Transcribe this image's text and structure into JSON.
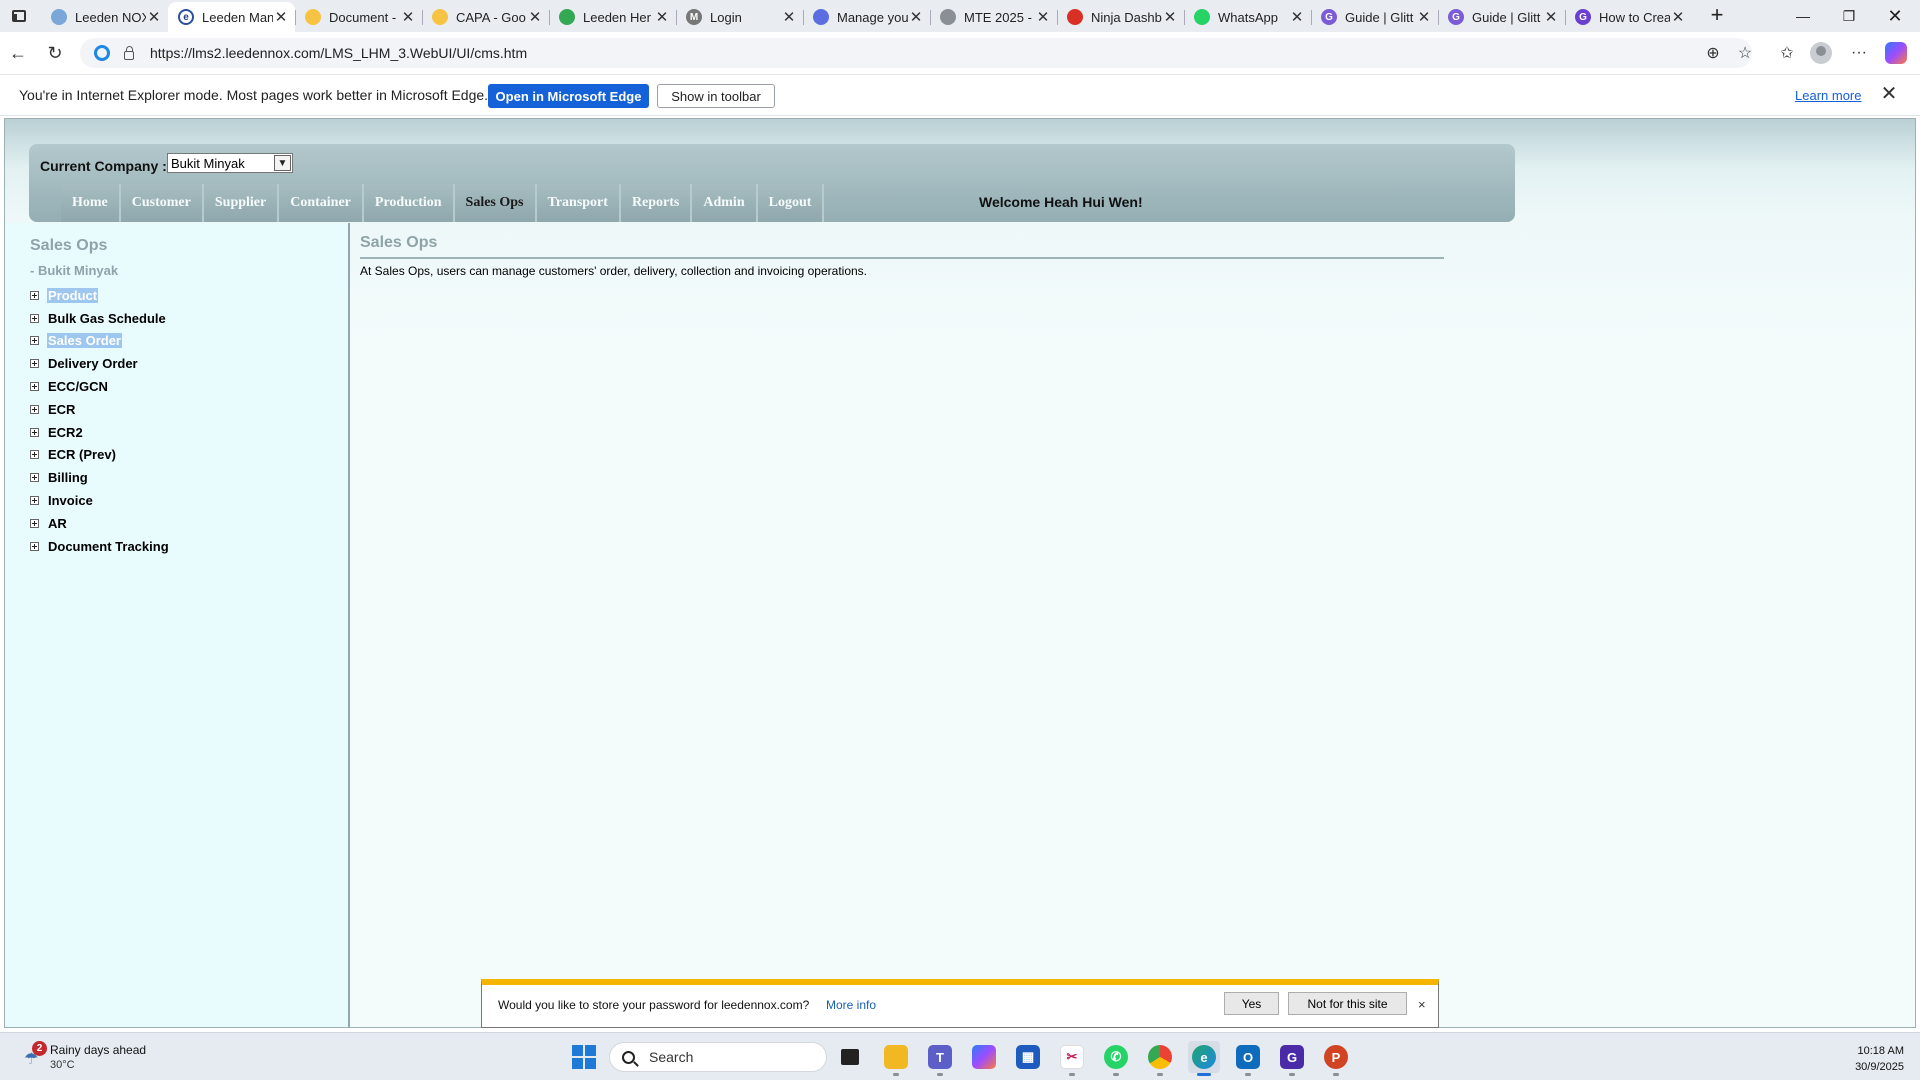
{
  "browser": {
    "tabs": [
      {
        "title": "Leeden NOX",
        "fav_color": "#7aa6d8",
        "fav_glyph": ""
      },
      {
        "title": "Leeden Man",
        "fav_color": "#ffffff",
        "fav_glyph": "e",
        "active": true
      },
      {
        "title": "Document -",
        "fav_color": "#f6c343",
        "fav_glyph": ""
      },
      {
        "title": "CAPA - Goo",
        "fav_color": "#f6c343",
        "fav_glyph": ""
      },
      {
        "title": "Leeden Her",
        "fav_color": "#34a853",
        "fav_glyph": ""
      },
      {
        "title": "Login",
        "fav_color": "#777777",
        "fav_glyph": "M"
      },
      {
        "title": "Manage you",
        "fav_color": "#5b6ee1",
        "fav_glyph": ""
      },
      {
        "title": "MTE 2025 -",
        "fav_color": "#8a8f96",
        "fav_glyph": ""
      },
      {
        "title": "Ninja Dashb",
        "fav_color": "#d93025",
        "fav_glyph": ""
      },
      {
        "title": "WhatsApp",
        "fav_color": "#25d366",
        "fav_glyph": ""
      },
      {
        "title": "Guide | Glitt",
        "fav_color": "#7b5cd6",
        "fav_glyph": "G"
      },
      {
        "title": "Guide | Glitt",
        "fav_color": "#7b5cd6",
        "fav_glyph": "G"
      },
      {
        "title": "How to Crea",
        "fav_color": "#6b3fd1",
        "fav_glyph": "G"
      }
    ],
    "new_tab": "+",
    "url": "https://lms2.leedennox.com/LMS_LHM_3.WebUI/UI/cms.htm"
  },
  "infobar": {
    "message": "You're in Internet Explorer mode. Most pages work better in Microsoft Edge.",
    "open_edge": "Open in Microsoft Edge",
    "show_toolbar": "Show in toolbar",
    "learn_more": "Learn more"
  },
  "header": {
    "company_label": "Current Company :",
    "company_value": "Bukit Minyak",
    "menu": [
      "Home",
      "Customer",
      "Supplier",
      "Container",
      "Production",
      "Sales Ops",
      "Transport",
      "Reports",
      "Admin",
      "Logout"
    ],
    "active_menu": "Sales Ops",
    "welcome": "Welcome Heah Hui Wen!"
  },
  "left_panel": {
    "title": "Sales Ops",
    "subtitle": "- Bukit Minyak",
    "items": [
      {
        "label": "Product",
        "selected": true
      },
      {
        "label": "Bulk Gas Schedule",
        "selected": false
      },
      {
        "label": "Sales Order",
        "selected": true
      },
      {
        "label": "Delivery Order",
        "selected": false
      },
      {
        "label": "ECC/GCN",
        "selected": false
      },
      {
        "label": "ECR",
        "selected": false
      },
      {
        "label": "ECR2",
        "selected": false
      },
      {
        "label": "ECR (Prev)",
        "selected": false
      },
      {
        "label": "Billing",
        "selected": false
      },
      {
        "label": "Invoice",
        "selected": false
      },
      {
        "label": "AR",
        "selected": false
      },
      {
        "label": "Document Tracking",
        "selected": false
      }
    ]
  },
  "content": {
    "title": "Sales Ops",
    "description": "At Sales Ops, users can manage customers' order, delivery, collection and invoicing operations."
  },
  "password_prompt": {
    "message": "Would you like to store your password for leedennox.com?",
    "more_info": "More info",
    "yes": "Yes",
    "never": "Not for this site",
    "close": "×"
  },
  "taskbar": {
    "weather_badge": "2",
    "weather_title": "Rainy days ahead",
    "weather_temp": "30°C",
    "search_label": "Search",
    "time": "10:18 AM",
    "date": "30/9/2025"
  }
}
